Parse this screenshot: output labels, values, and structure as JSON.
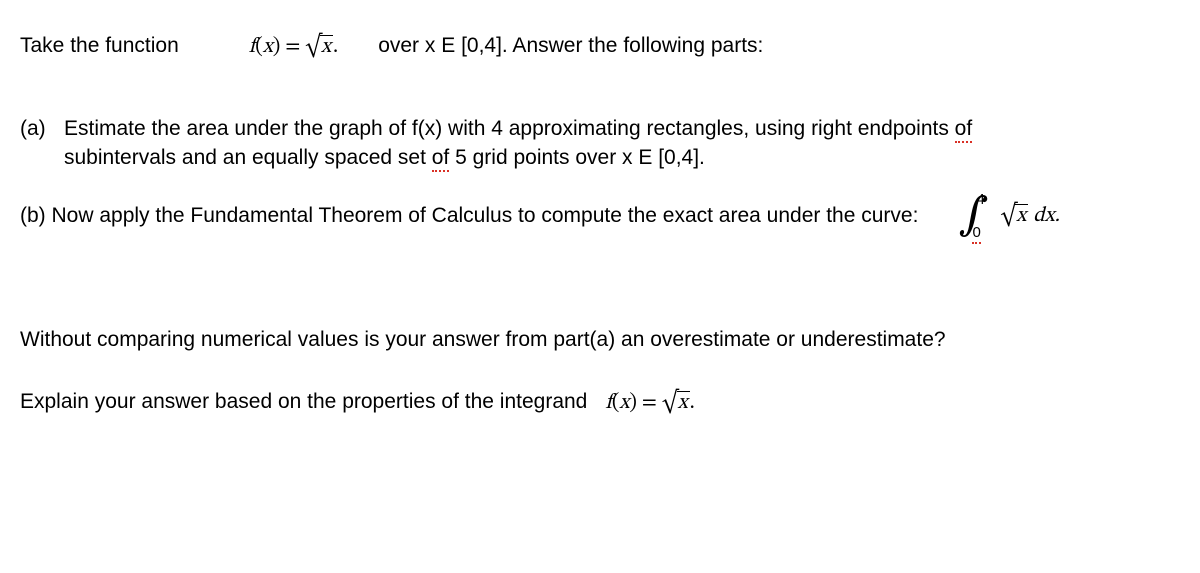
{
  "intro": {
    "lead": "Take the function",
    "fx_label": "f",
    "fx_paren_open": "(",
    "fx_var": "x",
    "fx_paren_close": ")",
    "fx_eq": " = ",
    "fx_sqrt_body": "x",
    "fx_period": ".",
    "trail": "over x E [0,4]. Answer the following parts:"
  },
  "part_a": {
    "label": "(a)",
    "line1_pre": "Estimate the area under the graph of f(x) with 4 approximating rectangles, using right endpoints ",
    "line1_spell": "of",
    "line2_pre": "subintervals and an equally spaced set ",
    "line2_spell": "of",
    "line2_post": " 5 grid points over x E [0,4]."
  },
  "part_b": {
    "label": "(b) ",
    "text": "Now apply the Fundamental Theorem of Calculus to compute the exact area under the curve:",
    "int_top": "4",
    "int_bot": "0",
    "int_sqrt_body": "x",
    "int_dx": " dx",
    "int_period": "."
  },
  "followup": {
    "q": "Without comparing numerical values is your answer from part(a) an overestimate or underestimate?"
  },
  "explain": {
    "text": "Explain your answer based on the properties of the integrand",
    "fx_label": "f",
    "fx_paren_open": "(",
    "fx_var": "x",
    "fx_paren_close": ")",
    "fx_eq": " = ",
    "fx_sqrt_body": "x",
    "fx_period": "."
  }
}
